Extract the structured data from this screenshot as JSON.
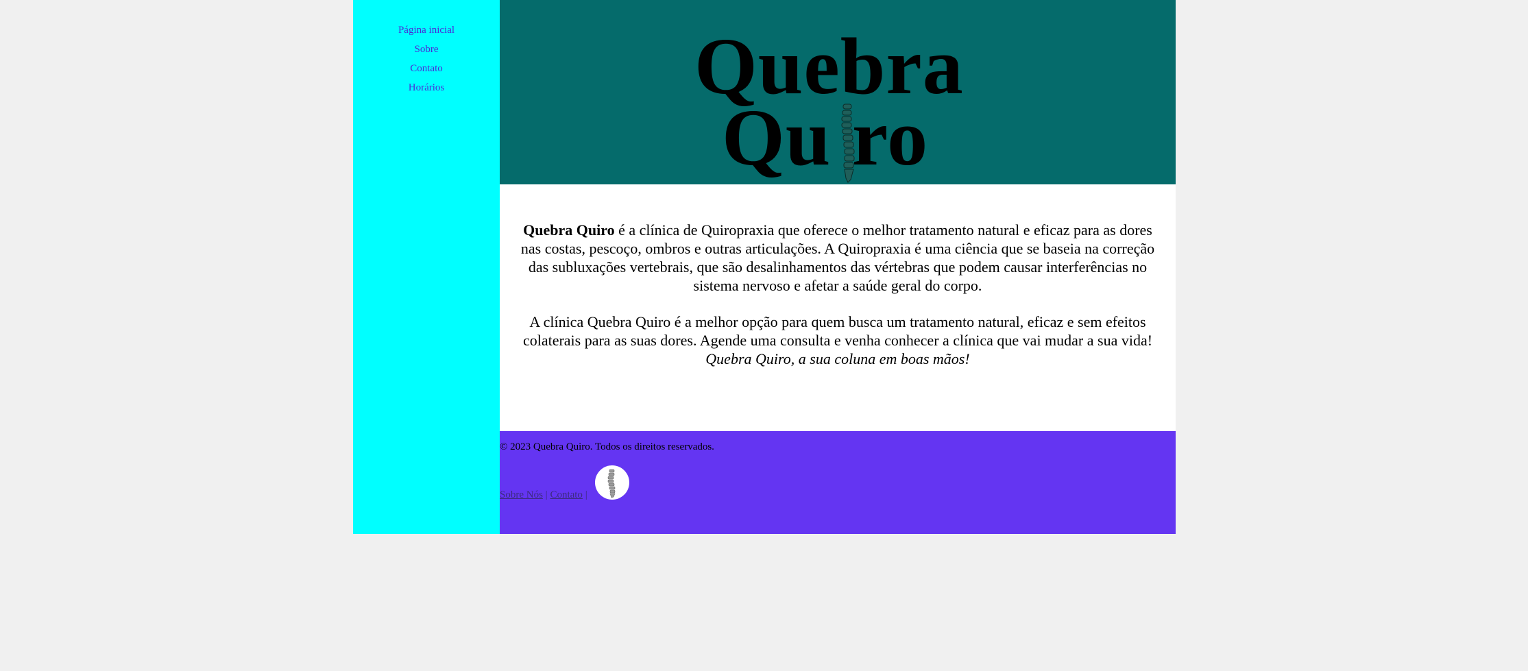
{
  "nav": {
    "items": [
      {
        "label": "Página inicial"
      },
      {
        "label": "Sobre"
      },
      {
        "label": "Contato"
      },
      {
        "label": "Horários"
      }
    ]
  },
  "header": {
    "logo_line1": "Quebra",
    "logo_line2": "Qu ro"
  },
  "main": {
    "p1_strong": "Quebra Quiro",
    "p1_text": " é a clínica de Quiropraxia que oferece o melhor tratamento natural e eficaz para as dores nas costas, pescoço, ombros e outras articulações. A Quiropraxia é uma ciência que se baseia na correção das subluxações vertebrais, que são desalinhamentos das vértebras que podem causar interferências no sistema nervoso e afetar a saúde geral do corpo.",
    "p2_text": "A clínica Quebra Quiro é a melhor opção para quem busca um tratamento natural, eficaz e sem efeitos colaterais para as suas dores. Agende uma consulta e venha conhecer a clínica que vai mudar a sua vida!",
    "tagline": "Quebra Quiro, a sua coluna em boas mãos!"
  },
  "footer": {
    "copyright": "© 2023 Quebra Quiro. Todos os direitos reservados.",
    "link_about": "Sobre Nós",
    "link_contact": "Contato",
    "separator": " | "
  },
  "colors": {
    "sidebar": "#00ffff",
    "header": "#056b6b",
    "footer": "#6435f2",
    "nav_link": "#4b2bd6"
  }
}
